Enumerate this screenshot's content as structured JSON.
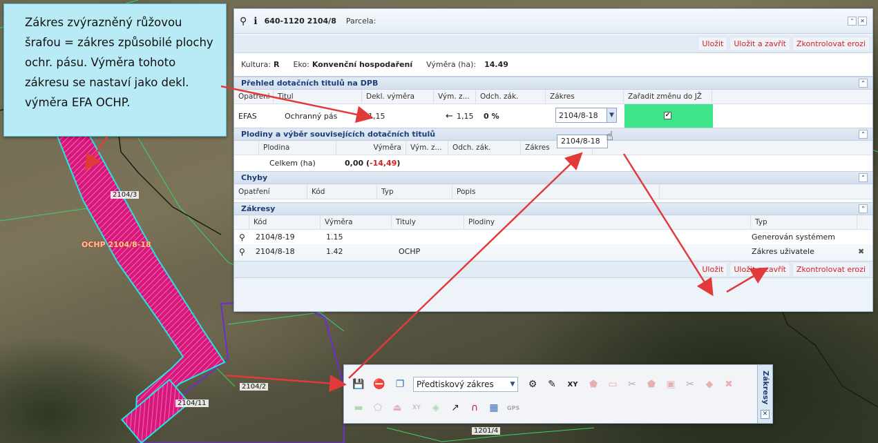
{
  "callout": {
    "text": "Zákres zvýrazněný růžovou šrafou = zákres způsobilé plochy ochr. pásu. Výměra tohoto zákresu se nastaví jako dekl. výměra EFA OCHP."
  },
  "map": {
    "labels": [
      "2104/3",
      "OCHP 2104/8-18",
      "2104/2",
      "2104/11",
      "1201/4"
    ]
  },
  "window": {
    "parcel_code": "640-1120 2104/8",
    "parcel_label": "Parcela:",
    "actions": [
      "Uložit",
      "Uložit a zavřít",
      "Zkontrolovat erozi"
    ],
    "info": {
      "kultura_label": "Kultura:",
      "kultura_value": "R",
      "eko_label": "Eko:",
      "eko_value": "Konvenční hospodaření",
      "vymera_label": "Výměra (ha):",
      "vymera_value": "14.49"
    },
    "sections": {
      "dpb": "Přehled dotačních titulů na DPB",
      "plodiny": "Plodiny a výběr souvisejících dotačních titulů",
      "chyby": "Chyby",
      "zakresy": "Zákresy"
    },
    "dpb_table": {
      "headers": [
        "Opatreni",
        "Titul",
        "Dekl. výměra",
        "Vým. z...",
        "Odch. zák.",
        "Zákres",
        "Zařadit změnu do JŽ"
      ],
      "row": {
        "opatreni": "EFAS",
        "titul": "Ochranný pás",
        "dekl": "1,15",
        "vym_z": "1,15",
        "odch": "0 %",
        "zakres": "2104/8-18",
        "zaradit_checked": true
      },
      "dropdown_option": "2104/8-18"
    },
    "plodiny_table": {
      "headers": [
        "Plodina",
        "Výměra",
        "Vým. z...",
        "Odch. zák.",
        "Zákres"
      ],
      "total_label": "Celkem (ha)",
      "total_value": "0,00",
      "total_diff": "-14,49"
    },
    "chyby_table": {
      "headers": [
        "Opatření",
        "Kód",
        "Typ",
        "Popis"
      ]
    },
    "zakresy_table": {
      "headers": [
        "Kód",
        "Výměra",
        "Tituly",
        "Plodiny",
        "Typ"
      ],
      "rows": [
        {
          "kod": "2104/8-19",
          "vymera": "1.15",
          "tituly": "",
          "plodiny": "",
          "typ": "Generován systémem"
        },
        {
          "kod": "2104/8-18",
          "vymera": "1.42",
          "tituly": "OCHP",
          "plodiny": "",
          "typ": "Zákres uživatele"
        }
      ]
    }
  },
  "draw_toolbar": {
    "title": "Zákresy",
    "mode_select": "Předtiskový zákres",
    "gps_label": "GPS"
  },
  "colors": {
    "accent_red": "#d32020",
    "section_blue": "#1c3f78",
    "highlight_green": "#3ee38a",
    "hatch_pink": "#d8177a",
    "callout_bg": "#b9ebf6"
  }
}
